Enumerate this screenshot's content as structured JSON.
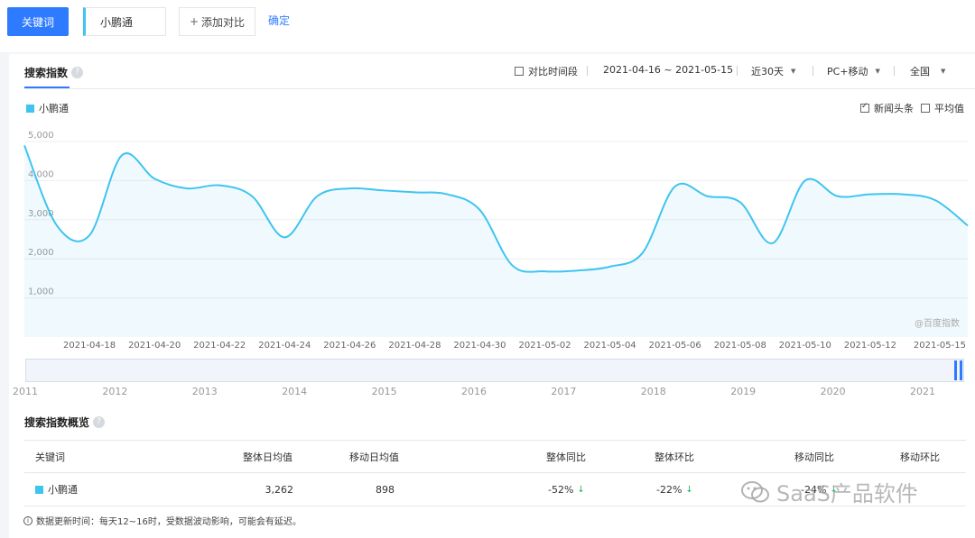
{
  "topbar": {
    "keyword_button": "关键词",
    "keyword_value": "小鹏通",
    "add_compare": "添加对比",
    "confirm": "确定"
  },
  "section1": {
    "title": "搜索指数",
    "compare_period": "对比时间段",
    "date_range": "2021-04-16 ~ 2021-05-15",
    "period": "近30天",
    "device": "PC+移动",
    "region": "全国",
    "news_headline": "新闻头条",
    "average": "平均值",
    "legend_label": "小鹏通",
    "source_mark": "@百度指数"
  },
  "colors": {
    "series": "#3fc4f0",
    "accent": "#2f7bff",
    "down_arrow": "#1bb35c"
  },
  "chart_data": {
    "type": "area",
    "series": [
      {
        "name": "小鹏通",
        "values": [
          4900,
          2850,
          2600,
          4650,
          4050,
          3800,
          3880,
          3600,
          2550,
          3600,
          3800,
          3750,
          3700,
          3650,
          3250,
          1830,
          1680,
          1700,
          1800,
          2150,
          3850,
          3600,
          3450,
          2400,
          4000,
          3600,
          3650,
          3650,
          3500,
          2850
        ]
      }
    ],
    "ytick_labels": [
      "5,000",
      "4,000",
      "3,000",
      "2,000",
      "1,000"
    ],
    "ylim": [
      0,
      5000
    ],
    "x_tick_labels": [
      "2021-04-18",
      "2021-04-20",
      "2021-04-22",
      "2021-04-24",
      "2021-04-26",
      "2021-04-28",
      "2021-04-30",
      "2021-05-02",
      "2021-05-04",
      "2021-05-06",
      "2021-05-08",
      "2021-05-10",
      "2021-05-12",
      "2021-05-15"
    ],
    "grid": true
  },
  "timeline": {
    "years": [
      "2011",
      "2012",
      "2013",
      "2014",
      "2015",
      "2016",
      "2017",
      "2018",
      "2019",
      "2020",
      "2021"
    ]
  },
  "section2": {
    "title": "搜索指数概览",
    "columns": [
      "关键词",
      "整体日均值",
      "移动日均值",
      "整体同比",
      "整体环比",
      "移动同比",
      "移动环比"
    ],
    "rows": [
      {
        "keyword": "小鹏通",
        "overall_avg": "3,262",
        "mobile_avg": "898",
        "overall_yoy": "-52%",
        "overall_qoq": "-22%",
        "mobile_yoy": "-24%",
        "mobile_qoq": "-"
      }
    ],
    "footnote": "数据更新时间：每天12~16时，受数据波动影响，可能会有延迟。"
  },
  "watermark": "SaaS产品软件"
}
